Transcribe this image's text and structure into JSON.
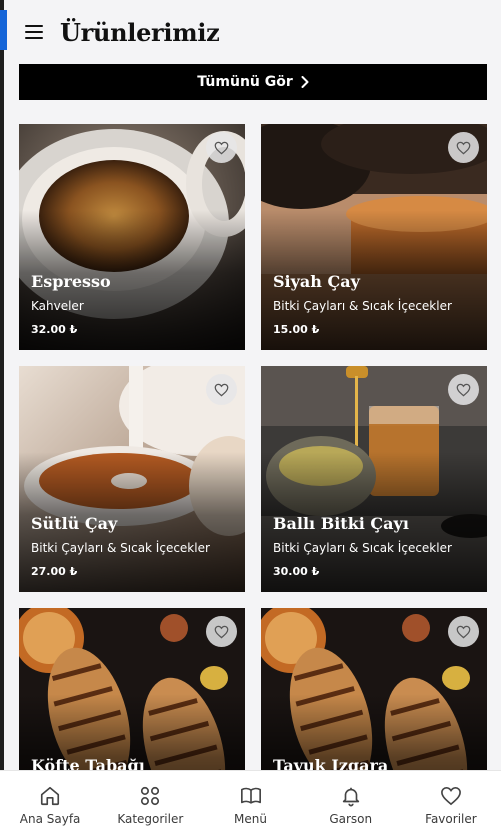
{
  "header": {
    "title": "Ürünlerimiz",
    "menu_icon": "hamburger-menu-icon"
  },
  "view_all": {
    "label": "Tümünü Gör",
    "icon": "chevron-right-icon"
  },
  "products": [
    {
      "name": "Espresso",
      "category": "Kahveler",
      "price": "32.00 ₺",
      "image": "espresso-cup"
    },
    {
      "name": "Siyah Çay",
      "category": "Bitki Çayları & Sıcak İçecekler",
      "price": "15.00 ₺",
      "image": "black-tea-glass"
    },
    {
      "name": "Sütlü Çay",
      "category": "Bitki Çayları & Sıcak İçecekler",
      "price": "27.00 ₺",
      "image": "milk-tea-pour"
    },
    {
      "name": "Ballı Bitki Çayı",
      "category": "Bitki Çayları & Sıcak İçecekler",
      "price": "30.00 ₺",
      "image": "honey-herbal-tea"
    },
    {
      "name": "Köfte Tabağı",
      "category": "",
      "price": "",
      "image": "grilled-meat"
    },
    {
      "name": "Tavuk Izgara",
      "category": "",
      "price": "",
      "image": "grilled-chicken"
    }
  ],
  "nav": [
    {
      "label": "Ana Sayfa",
      "icon": "home-icon"
    },
    {
      "label": "Kategoriler",
      "icon": "categories-icon"
    },
    {
      "label": "Menü",
      "icon": "book-icon"
    },
    {
      "label": "Garson",
      "icon": "bell-icon"
    },
    {
      "label": "Favoriler",
      "icon": "heart-icon"
    }
  ],
  "colors": {
    "accent": "#1565d8",
    "button_bg": "#000000",
    "background": "#f4f4f6"
  }
}
